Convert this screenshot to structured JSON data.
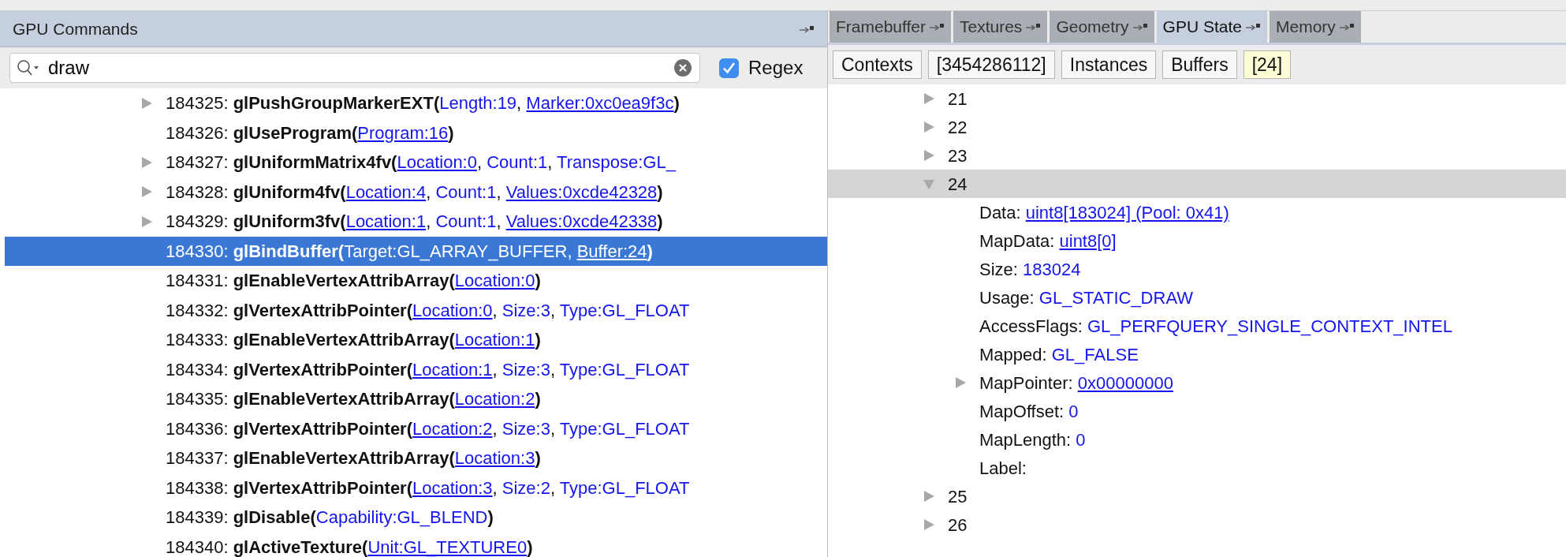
{
  "commands_panel": {
    "title": "GPU Commands",
    "search": {
      "value": "draw",
      "regex_label": "Regex",
      "regex_checked": true
    },
    "commands": [
      {
        "expandable": true,
        "selected": false,
        "parts": [
          {
            "kind": "plain",
            "text": "184325: "
          },
          {
            "kind": "name",
            "text": "glPushGroupMarkerEXT("
          },
          {
            "kind": "value",
            "text": "Length:19"
          },
          {
            "kind": "plain",
            "text": ", "
          },
          {
            "kind": "link",
            "text": "Marker:0xc0ea9f3c"
          },
          {
            "kind": "name",
            "text": ")"
          }
        ]
      },
      {
        "expandable": false,
        "selected": false,
        "parts": [
          {
            "kind": "plain",
            "text": "184326: "
          },
          {
            "kind": "name",
            "text": "glUseProgram("
          },
          {
            "kind": "link",
            "text": "Program:16"
          },
          {
            "kind": "name",
            "text": ")"
          }
        ]
      },
      {
        "expandable": true,
        "selected": false,
        "parts": [
          {
            "kind": "plain",
            "text": "184327: "
          },
          {
            "kind": "name",
            "text": "glUniformMatrix4fv("
          },
          {
            "kind": "link",
            "text": "Location:0"
          },
          {
            "kind": "plain",
            "text": ", "
          },
          {
            "kind": "value",
            "text": "Count:1"
          },
          {
            "kind": "plain",
            "text": ", "
          },
          {
            "kind": "value",
            "text": "Transpose:GL_"
          }
        ]
      },
      {
        "expandable": true,
        "selected": false,
        "parts": [
          {
            "kind": "plain",
            "text": "184328: "
          },
          {
            "kind": "name",
            "text": "glUniform4fv("
          },
          {
            "kind": "link",
            "text": "Location:4"
          },
          {
            "kind": "plain",
            "text": ", "
          },
          {
            "kind": "value",
            "text": "Count:1"
          },
          {
            "kind": "plain",
            "text": ", "
          },
          {
            "kind": "link",
            "text": "Values:0xcde42328"
          },
          {
            "kind": "name",
            "text": ")"
          }
        ]
      },
      {
        "expandable": true,
        "selected": false,
        "parts": [
          {
            "kind": "plain",
            "text": "184329: "
          },
          {
            "kind": "name",
            "text": "glUniform3fv("
          },
          {
            "kind": "link",
            "text": "Location:1"
          },
          {
            "kind": "plain",
            "text": ", "
          },
          {
            "kind": "value",
            "text": "Count:1"
          },
          {
            "kind": "plain",
            "text": ", "
          },
          {
            "kind": "link",
            "text": "Values:0xcde42338"
          },
          {
            "kind": "name",
            "text": ")"
          }
        ]
      },
      {
        "expandable": false,
        "selected": true,
        "parts": [
          {
            "kind": "plain",
            "text": "184330: "
          },
          {
            "kind": "name",
            "text": "glBindBuffer("
          },
          {
            "kind": "value",
            "text": "Target:GL_ARRAY_BUFFER"
          },
          {
            "kind": "plain",
            "text": ", "
          },
          {
            "kind": "link",
            "text": "Buffer:24"
          },
          {
            "kind": "name",
            "text": ")"
          }
        ]
      },
      {
        "expandable": false,
        "selected": false,
        "parts": [
          {
            "kind": "plain",
            "text": "184331: "
          },
          {
            "kind": "name",
            "text": "glEnableVertexAttribArray("
          },
          {
            "kind": "link",
            "text": "Location:0"
          },
          {
            "kind": "name",
            "text": ")"
          }
        ]
      },
      {
        "expandable": false,
        "selected": false,
        "parts": [
          {
            "kind": "plain",
            "text": "184332: "
          },
          {
            "kind": "name",
            "text": "glVertexAttribPointer("
          },
          {
            "kind": "link",
            "text": "Location:0"
          },
          {
            "kind": "plain",
            "text": ", "
          },
          {
            "kind": "value",
            "text": "Size:3"
          },
          {
            "kind": "plain",
            "text": ", "
          },
          {
            "kind": "value",
            "text": "Type:GL_FLOAT"
          }
        ]
      },
      {
        "expandable": false,
        "selected": false,
        "parts": [
          {
            "kind": "plain",
            "text": "184333: "
          },
          {
            "kind": "name",
            "text": "glEnableVertexAttribArray("
          },
          {
            "kind": "link",
            "text": "Location:1"
          },
          {
            "kind": "name",
            "text": ")"
          }
        ]
      },
      {
        "expandable": false,
        "selected": false,
        "parts": [
          {
            "kind": "plain",
            "text": "184334: "
          },
          {
            "kind": "name",
            "text": "glVertexAttribPointer("
          },
          {
            "kind": "link",
            "text": "Location:1"
          },
          {
            "kind": "plain",
            "text": ", "
          },
          {
            "kind": "value",
            "text": "Size:3"
          },
          {
            "kind": "plain",
            "text": ", "
          },
          {
            "kind": "value",
            "text": "Type:GL_FLOAT"
          }
        ]
      },
      {
        "expandable": false,
        "selected": false,
        "parts": [
          {
            "kind": "plain",
            "text": "184335: "
          },
          {
            "kind": "name",
            "text": "glEnableVertexAttribArray("
          },
          {
            "kind": "link",
            "text": "Location:2"
          },
          {
            "kind": "name",
            "text": ")"
          }
        ]
      },
      {
        "expandable": false,
        "selected": false,
        "parts": [
          {
            "kind": "plain",
            "text": "184336: "
          },
          {
            "kind": "name",
            "text": "glVertexAttribPointer("
          },
          {
            "kind": "link",
            "text": "Location:2"
          },
          {
            "kind": "plain",
            "text": ", "
          },
          {
            "kind": "value",
            "text": "Size:3"
          },
          {
            "kind": "plain",
            "text": ", "
          },
          {
            "kind": "value",
            "text": "Type:GL_FLOAT"
          }
        ]
      },
      {
        "expandable": false,
        "selected": false,
        "parts": [
          {
            "kind": "plain",
            "text": "184337: "
          },
          {
            "kind": "name",
            "text": "glEnableVertexAttribArray("
          },
          {
            "kind": "link",
            "text": "Location:3"
          },
          {
            "kind": "name",
            "text": ")"
          }
        ]
      },
      {
        "expandable": false,
        "selected": false,
        "parts": [
          {
            "kind": "plain",
            "text": "184338: "
          },
          {
            "kind": "name",
            "text": "glVertexAttribPointer("
          },
          {
            "kind": "link",
            "text": "Location:3"
          },
          {
            "kind": "plain",
            "text": ", "
          },
          {
            "kind": "value",
            "text": "Size:2"
          },
          {
            "kind": "plain",
            "text": ", "
          },
          {
            "kind": "value",
            "text": "Type:GL_FLOAT"
          }
        ]
      },
      {
        "expandable": false,
        "selected": false,
        "parts": [
          {
            "kind": "plain",
            "text": "184339: "
          },
          {
            "kind": "name",
            "text": "glDisable("
          },
          {
            "kind": "value",
            "text": "Capability:GL_BLEND"
          },
          {
            "kind": "name",
            "text": ")"
          }
        ]
      },
      {
        "expandable": false,
        "selected": false,
        "parts": [
          {
            "kind": "plain",
            "text": "184340: "
          },
          {
            "kind": "name",
            "text": "glActiveTexture("
          },
          {
            "kind": "link",
            "text": "Unit:GL_TEXTURE0"
          },
          {
            "kind": "name",
            "text": ")"
          }
        ]
      }
    ]
  },
  "state_panel": {
    "tabs": [
      {
        "label": "Framebuffer",
        "selected": false
      },
      {
        "label": "Textures",
        "selected": false
      },
      {
        "label": "Geometry",
        "selected": false
      },
      {
        "label": "GPU State",
        "selected": true
      },
      {
        "label": "Memory",
        "selected": false
      }
    ],
    "path": [
      {
        "label": "Contexts",
        "current": false
      },
      {
        "label": "[3454286112]",
        "current": false
      },
      {
        "label": "Instances",
        "current": false
      },
      {
        "label": "Buffers",
        "current": false
      },
      {
        "label": "[24]",
        "current": true
      }
    ],
    "tree": [
      {
        "label": "21",
        "expanded": false,
        "selected": false
      },
      {
        "label": "22",
        "expanded": false,
        "selected": false
      },
      {
        "label": "23",
        "expanded": false,
        "selected": false
      },
      {
        "label": "24",
        "expanded": true,
        "selected": true,
        "children": [
          {
            "key": "Data:",
            "value": "uint8[183024] (Pool: 0x41)",
            "kind": "link",
            "expandable": false
          },
          {
            "key": "MapData:",
            "value": "uint8[0]",
            "kind": "link",
            "expandable": false
          },
          {
            "key": "Size:",
            "value": "183024",
            "kind": "value",
            "expandable": false
          },
          {
            "key": "Usage:",
            "value": "GL_STATIC_DRAW",
            "kind": "value",
            "expandable": false
          },
          {
            "key": "AccessFlags:",
            "value": "GL_PERFQUERY_SINGLE_CONTEXT_INTEL",
            "kind": "value",
            "expandable": false
          },
          {
            "key": "Mapped:",
            "value": "GL_FALSE",
            "kind": "value",
            "expandable": false
          },
          {
            "key": "MapPointer:",
            "value": "0x00000000",
            "kind": "link",
            "expandable": true
          },
          {
            "key": "MapOffset:",
            "value": "0",
            "kind": "value",
            "expandable": false
          },
          {
            "key": "MapLength:",
            "value": "0",
            "kind": "value",
            "expandable": false
          },
          {
            "key": "Label:",
            "kind": "empty",
            "expandable": false
          }
        ]
      },
      {
        "label": "25",
        "expanded": false,
        "selected": false
      },
      {
        "label": "26",
        "expanded": false,
        "selected": false
      }
    ]
  }
}
